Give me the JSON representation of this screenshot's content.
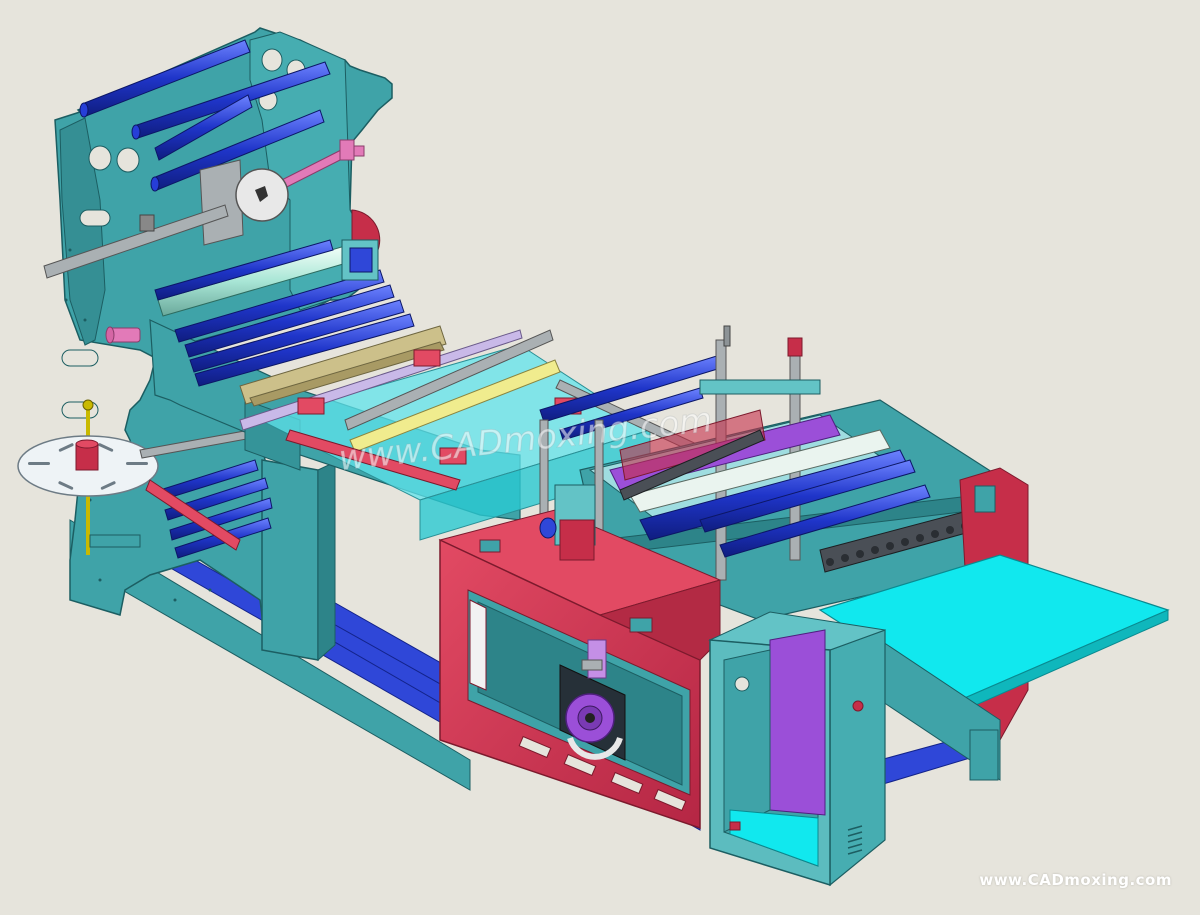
{
  "scene": {
    "subject": "bag-making-machine-cad-model",
    "colors": {
      "background": "#e6e4dc",
      "frame_teal": "#3fa3a8",
      "frame_teal_dark": "#2d8489",
      "frame_teal_light": "#63c3c6",
      "roller_blue": "#1f35c9",
      "roller_blue_light": "#4a63e6",
      "housing_red": "#d83a55",
      "housing_red_dark": "#b32a44",
      "cabinet_purple": "#9b4fd8",
      "table_cyan": "#11e8ee",
      "sealing_yellow": "#f0ec8e",
      "dancer_gray": "#aab0b3",
      "pink_guide": "#e27ab8"
    }
  },
  "watermarks": {
    "center_text": "www.CADmoxing.com",
    "corner_text": "www.CADmoxing.com"
  }
}
